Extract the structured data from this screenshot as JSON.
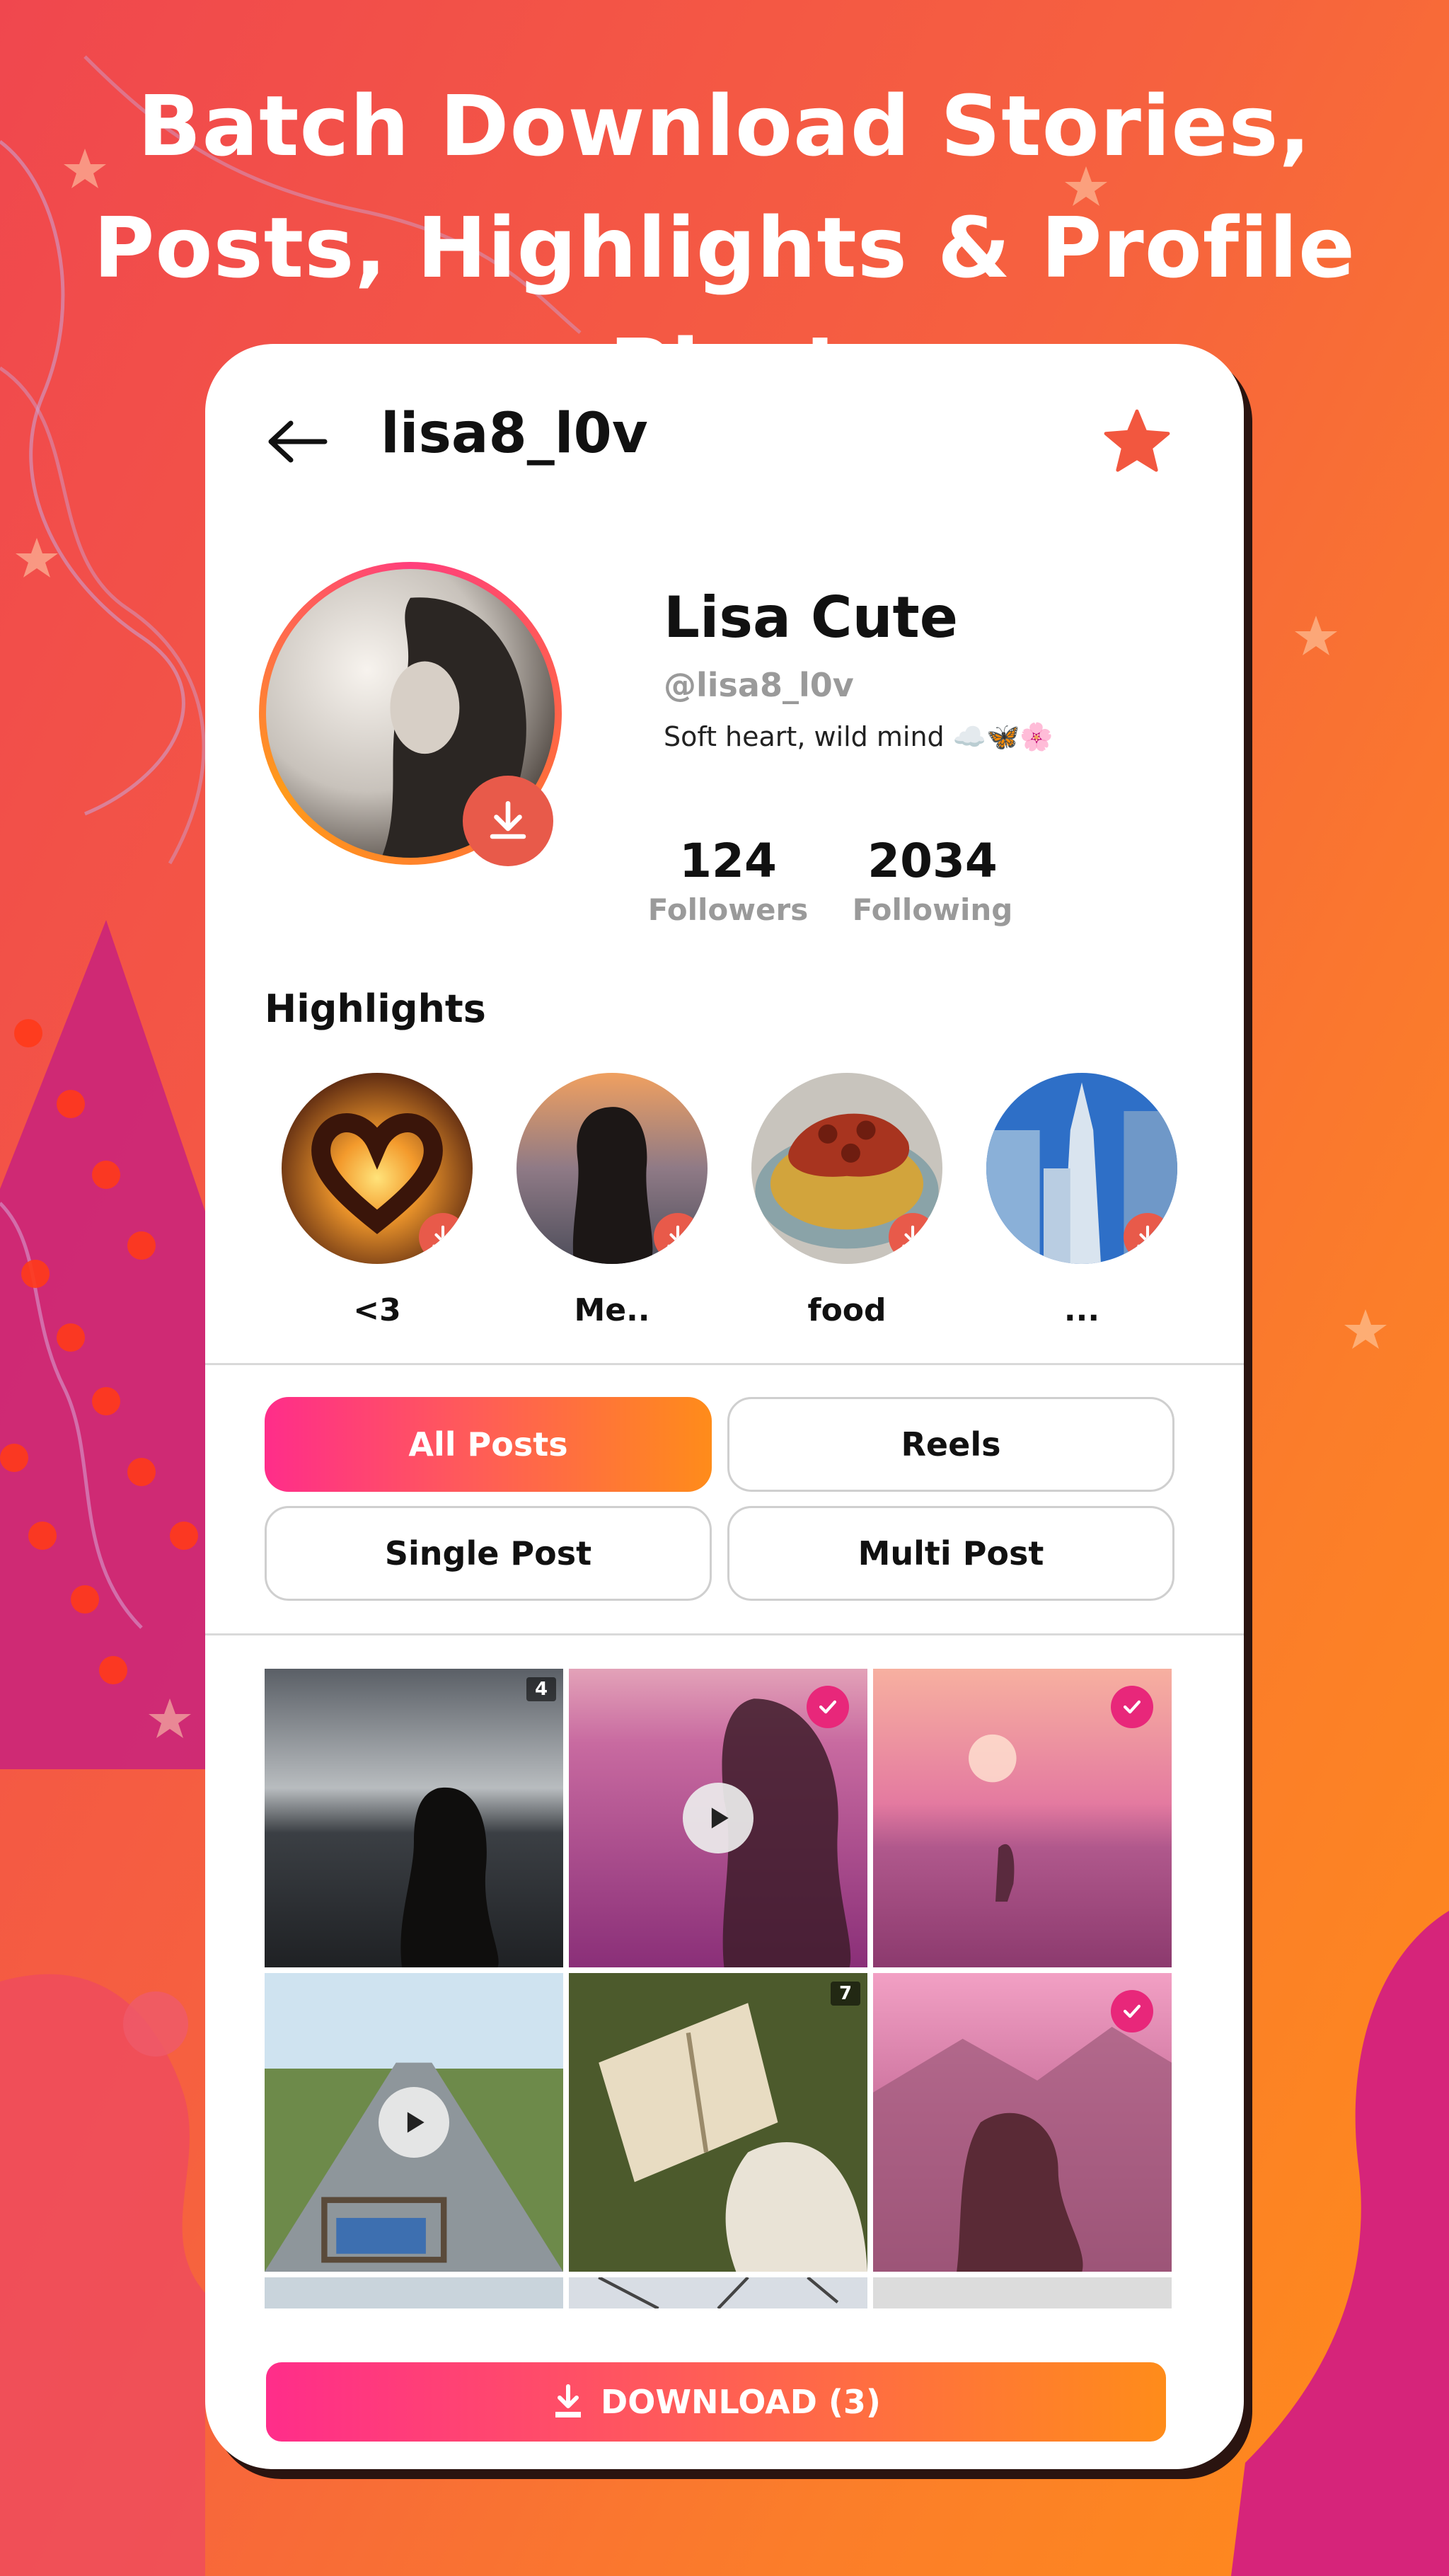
{
  "headline": {
    "line1": "Batch Download Stories,",
    "line2": "Posts, Highlights & Profile Pics!"
  },
  "header": {
    "username": "lisa8_l0v",
    "back_icon": "arrow-left-icon",
    "favorite_icon": "star-icon"
  },
  "profile": {
    "display_name": "Lisa Cute",
    "handle": "@lisa8_l0v",
    "bio": "Soft heart, wild mind ☁️🦋🌸",
    "followers_count": "124",
    "followers_label": "Followers",
    "following_count": "2034",
    "following_label": "Following"
  },
  "highlights": {
    "title": "Highlights",
    "items": [
      {
        "label": "<3"
      },
      {
        "label": "Me.."
      },
      {
        "label": "food"
      },
      {
        "label": "..."
      }
    ]
  },
  "tabs": {
    "all_posts": "All Posts",
    "reels": "Reels",
    "single_post": "Single Post",
    "multi_post": "Multi Post",
    "active": "All Posts"
  },
  "grid": {
    "items": [
      {
        "type": "multi",
        "count": "4",
        "selected": false
      },
      {
        "type": "video",
        "count": "",
        "selected": true
      },
      {
        "type": "photo",
        "count": "",
        "selected": true
      },
      {
        "type": "video",
        "count": "",
        "selected": false
      },
      {
        "type": "multi",
        "count": "7",
        "selected": false
      },
      {
        "type": "photo",
        "count": "",
        "selected": true
      }
    ]
  },
  "download_button": {
    "label": "DOWNLOAD (3)",
    "icon": "download-icon"
  },
  "colors": {
    "accent_pink": "#ff2d8a",
    "accent_orange": "#ff8c1a",
    "download_badge": "#e85a4a",
    "check_badge": "#e8277a"
  }
}
